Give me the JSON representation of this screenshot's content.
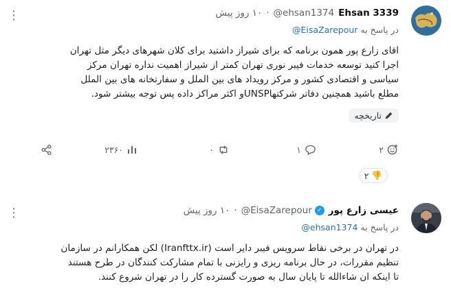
{
  "post1": {
    "display_name": "Ehsan 3339",
    "handle": "@ehsan1374",
    "time": "۱۰ روز پیش",
    "reply_prefix": "در پاسخ به",
    "reply_to": "@EisaZarepour",
    "body_lines": [
      "اقای زارع پور همون برنامه که برای شیراز داشتید برای کلان شهرهای دیگر مثل تهران",
      "اجرا کنید توسعه خدمات فیبر نوری تهران کمتر از شیراز اهمیت نداره تهران مرکز",
      "سیاسی و اقتصادی کشور و مرکز رویداد های بین الملل و سفارتخانه های بین الملل",
      "مطلع باشید همچنین دفاتر شرکتهاUNSPو اکثر مراکز داده پس توجه بیشتر شود."
    ],
    "history_label": "تاریخچه",
    "stats": {
      "reactions": "۲",
      "replies": "۱",
      "retweets": "۰",
      "views": "۲۳۶۰"
    },
    "reaction_badge": {
      "emoji": "👎",
      "count": "۲"
    }
  },
  "post2": {
    "display_name": "عیسی زارع پور",
    "handle": "@EisaZarepour",
    "time": "۱۰ روز پیش",
    "reply_prefix": "در پاسخ به",
    "reply_to": "@ehsan1374",
    "body_lines": [
      "در تهران در برخی نقاط سرویس فیبر دایر است (Iranfttx.ir) لکن همکارانم در سازمان",
      "تنظیم مقررات، در حال برنامه ریزی و رایزنی با تمام مشارکت کنندگان در طرح هستند",
      "تا اینکه ان شاءالله  تا پایان سال به صورت گسترده کار را در تهران شروع کنند."
    ]
  },
  "colors": {
    "link": "#1d72c4",
    "muted": "#5f6368",
    "verified": "#1d9bf0"
  }
}
